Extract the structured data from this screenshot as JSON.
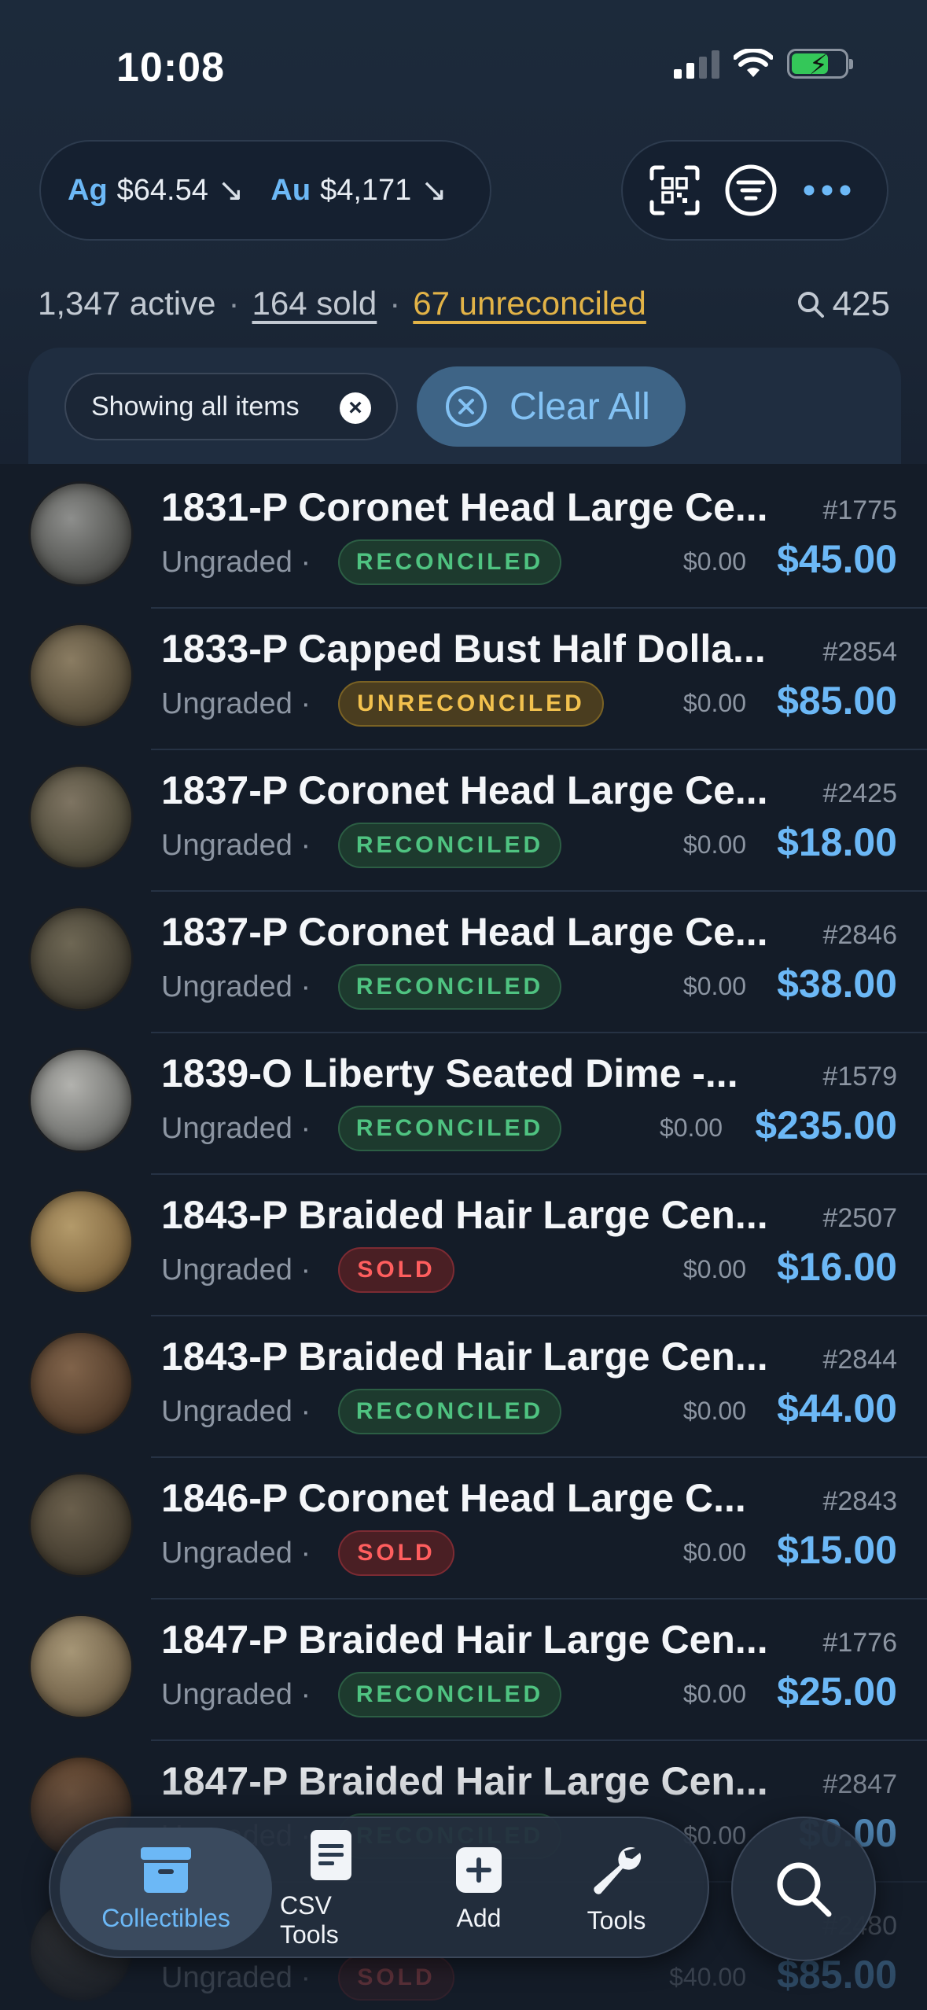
{
  "status_bar": {
    "time": "10:08"
  },
  "metals": {
    "silver": {
      "symbol": "Ag",
      "price": "$64.54",
      "trend": "↘"
    },
    "gold": {
      "symbol": "Au",
      "price": "$4,171",
      "trend": "↘"
    }
  },
  "actions": {
    "icons": [
      "qr-scan-icon",
      "filter-icon",
      "more-icon"
    ]
  },
  "summary": {
    "active": "1,347 active",
    "separator": "·",
    "sold": "164 sold",
    "unreconciled": "67 unreconciled",
    "search_count": "425"
  },
  "filter": {
    "chip_label": "Showing all items",
    "chip_close": "×",
    "clear_all": "Clear All"
  },
  "items": [
    {
      "title": "1831-P Coronet Head Large Ce...",
      "id": "#1775",
      "grade": "Ungraded",
      "dot": "·",
      "status": "RECONCILED",
      "status_type": "reconciled",
      "cost": "$0.00",
      "price": "$45.00"
    },
    {
      "title": "1833-P Capped Bust Half Dolla...",
      "id": "#2854",
      "grade": "Ungraded",
      "dot": "·",
      "status": "UNRECONCILED",
      "status_type": "unreconciled",
      "cost": "$0.00",
      "price": "$85.00"
    },
    {
      "title": "1837-P Coronet Head Large Ce...",
      "id": "#2425",
      "grade": "Ungraded",
      "dot": "·",
      "status": "RECONCILED",
      "status_type": "reconciled",
      "cost": "$0.00",
      "price": "$18.00"
    },
    {
      "title": "1837-P Coronet Head Large Ce...",
      "id": "#2846",
      "grade": "Ungraded",
      "dot": "·",
      "status": "RECONCILED",
      "status_type": "reconciled",
      "cost": "$0.00",
      "price": "$38.00"
    },
    {
      "title": "1839-O Liberty Seated Dime -...",
      "id": "#1579",
      "grade": "Ungraded",
      "dot": "·",
      "status": "RECONCILED",
      "status_type": "reconciled",
      "cost": "$0.00",
      "price": "$235.00"
    },
    {
      "title": "1843-P Braided Hair Large Cen...",
      "id": "#2507",
      "grade": "Ungraded",
      "dot": "·",
      "status": "SOLD",
      "status_type": "sold",
      "cost": "$0.00",
      "price": "$16.00"
    },
    {
      "title": "1843-P Braided Hair Large Cen...",
      "id": "#2844",
      "grade": "Ungraded",
      "dot": "·",
      "status": "RECONCILED",
      "status_type": "reconciled",
      "cost": "$0.00",
      "price": "$44.00"
    },
    {
      "title": "1846-P Coronet Head Large C...",
      "id": "#2843",
      "grade": "Ungraded",
      "dot": "·",
      "status": "SOLD",
      "status_type": "sold",
      "cost": "$0.00",
      "price": "$15.00"
    },
    {
      "title": "1847-P Braided Hair Large Cen...",
      "id": "#1776",
      "grade": "Ungraded",
      "dot": "·",
      "status": "RECONCILED",
      "status_type": "reconciled",
      "cost": "$0.00",
      "price": "$25.00"
    },
    {
      "title": "1847-P Braided Hair Large Cen...",
      "id": "#2847",
      "grade": "Ungraded",
      "dot": "·",
      "status": "RECONCILED",
      "status_type": "reconciled",
      "cost": "$0.00",
      "price": "$0.00"
    },
    {
      "title": "",
      "id": "#2480",
      "grade": "Ungraded",
      "dot": "·",
      "status": "SOLD",
      "status_type": "sold",
      "cost": "$40.00",
      "price": "$85.00"
    }
  ],
  "tabbar": {
    "tabs": [
      {
        "label": "Collectibles",
        "icon": "archive-box-icon",
        "active": true
      },
      {
        "label": "CSV Tools",
        "icon": "document-icon",
        "active": false
      },
      {
        "label": "Add",
        "icon": "plus-square-icon",
        "active": false
      },
      {
        "label": "Tools",
        "icon": "wrench-icon",
        "active": false
      }
    ],
    "search_icon": "search-icon"
  },
  "colors": {
    "background": "#141c28",
    "accent": "#6cb8f6",
    "reconciled": "#4fc381",
    "unreconciled": "#f2c14e",
    "sold": "#ff5e5e",
    "unreconciled_link": "#e2b347"
  }
}
